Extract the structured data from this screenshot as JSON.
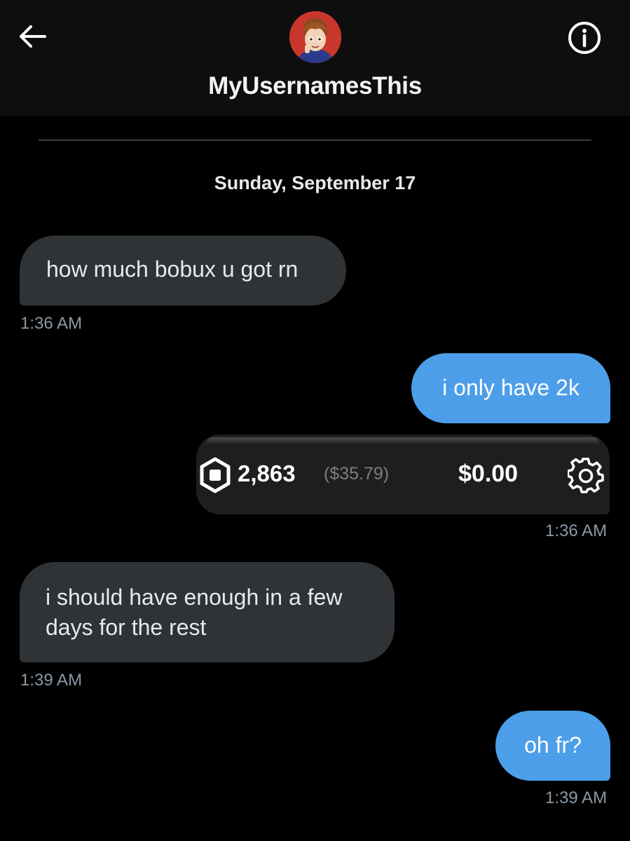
{
  "header": {
    "username": "MyUsernamesThis",
    "back_icon": "arrow-left-icon",
    "info_icon": "info-icon"
  },
  "conversation": {
    "date_separator": "Sunday, September 17",
    "messages": [
      {
        "direction": "received",
        "text": "how much bobux u got rn",
        "time": "1:36 AM"
      },
      {
        "direction": "sent",
        "text": "i only have 2k"
      },
      {
        "direction": "sent",
        "attachment": {
          "robux_amount": "2,863",
          "robux_usd": "($35.79)",
          "balance": "$0.00",
          "robux_icon": "robux-icon",
          "settings_icon": "gear-icon"
        },
        "time": "1:36 AM"
      },
      {
        "direction": "received",
        "lines": [
          "i should have enough in a few",
          "days for the rest"
        ],
        "time": "1:39 AM"
      },
      {
        "direction": "sent",
        "text": "oh fr?",
        "time": "1:39 AM"
      }
    ]
  },
  "colors": {
    "background": "#000000",
    "header_bg": "#0e0e0e",
    "received_bubble": "#2f3336",
    "sent_bubble": "#4c9ee8",
    "timestamp": "#8b98a5"
  }
}
